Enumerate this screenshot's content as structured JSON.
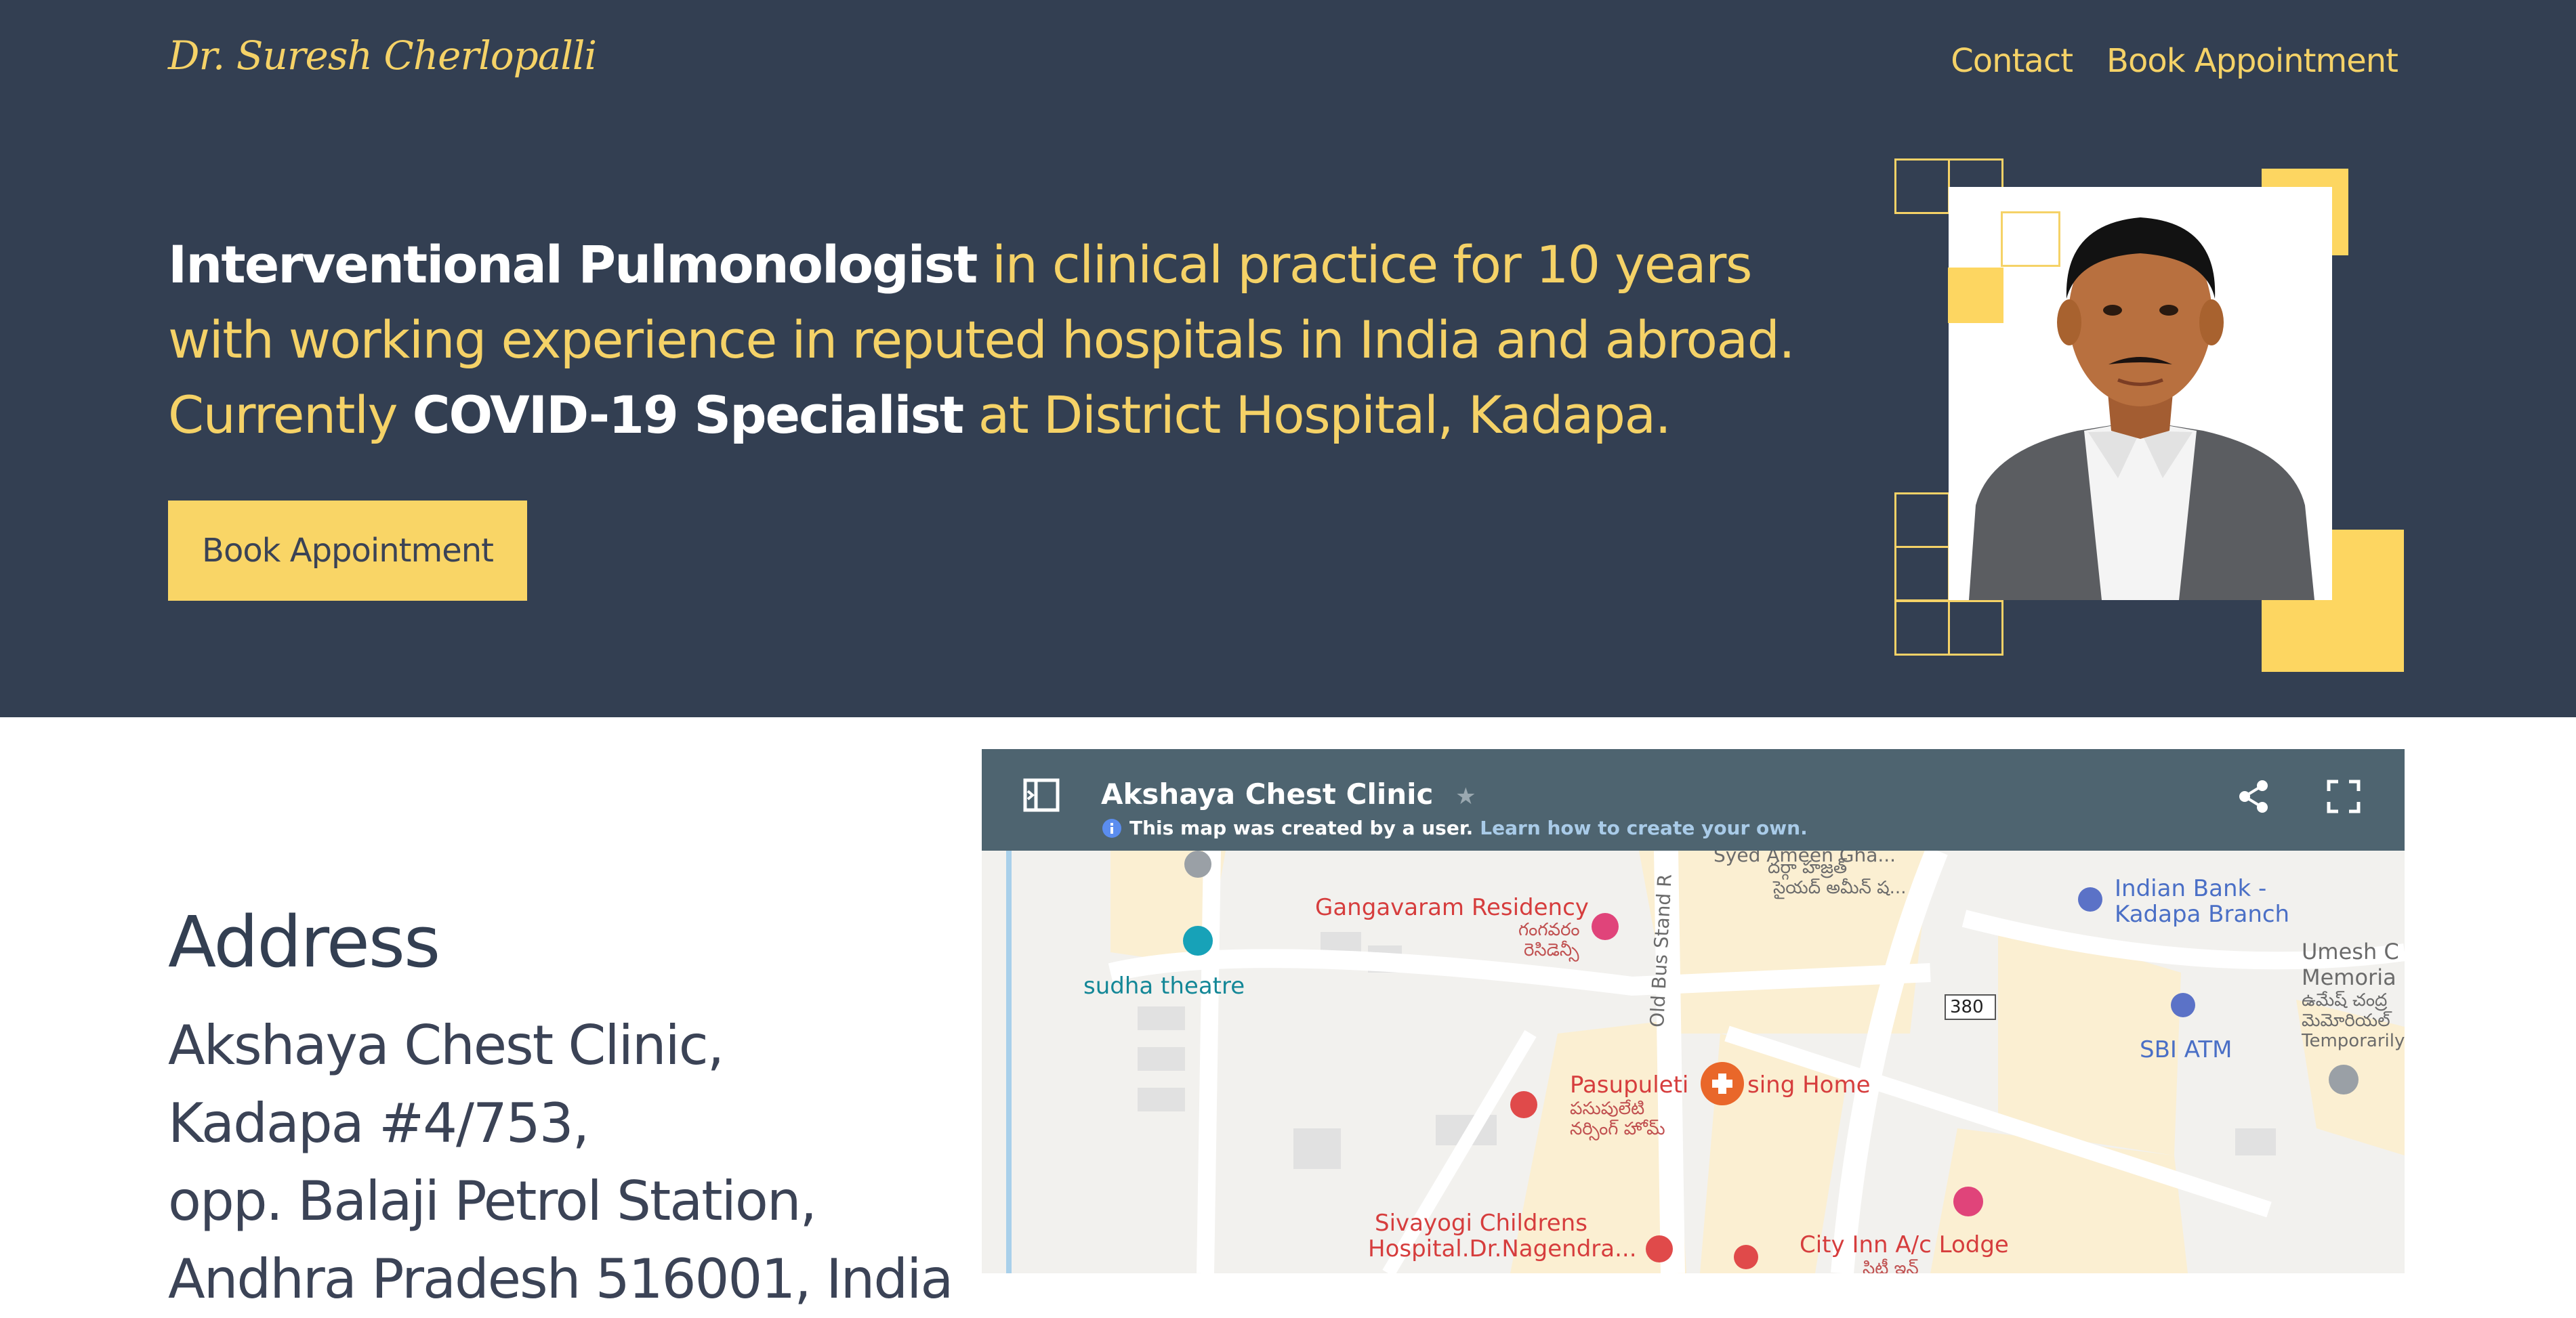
{
  "header": {
    "brand": "Dr. Suresh Cherlopalli",
    "nav": {
      "contact": "Contact",
      "book": "Book Appointment"
    }
  },
  "hero": {
    "part1_bold": "Interventional Pulmonologist",
    "part2": " in clinical practice for 10 years with working experience in reputed hospitals in India and abroad. Currently ",
    "part3_bold": "COVID-19 Specialist",
    "part4": " at District Hospital, Kadapa.",
    "cta": "Book Appointment"
  },
  "address": {
    "title": "Address",
    "lines": [
      "Akshaya Chest Clinic,",
      "Kadapa #4/753,",
      "opp. Balaji Petrol Station,",
      "Andhra Pradesh 516001, India"
    ]
  },
  "map": {
    "title": "Akshaya Chest Clinic",
    "notice": "This map was created by a user.",
    "learn_link": "Learn how to create your own.",
    "places": {
      "gangavaram": "Gangavaram Residency",
      "gangavaram_te": "గంగవరం",
      "gangavaram_te2": "రెసిడెన్సీ",
      "sudha": "sudha theatre",
      "road": "Old Bus Stand R",
      "syed": "Syed Ameen Gha...",
      "syed_te": "దర్గా హజ్రత్",
      "syed_te2": "సైయద్ అమీన్ ష...",
      "indian_bank": "Indian Bank -",
      "indian_bank2": "Kadapa Branch",
      "umesh": "Umesh C",
      "memorial": "Memoria",
      "umesh_te": "ఉమేష్ చంద్ర",
      "umesh_te2": "మెమోరియల్",
      "temporarily": "Temporarily",
      "sbi": "SBI ATM",
      "route": "380",
      "pasupuleti": "Pasupuleti",
      "nursing": "sing Home",
      "pasupuleti_te": "పసుపులేటి",
      "pasupuleti_te2": "నర్సింగ్ హోమ్",
      "sivayogi": "Sivayogi Childrens",
      "sivayogi2": "Hospital.Dr.Nagendra...",
      "cityinn": "City Inn A/c Lodge",
      "cityinn_te": "సిటీ ఇన్"
    }
  },
  "colors": {
    "navy": "#333f52",
    "yellow": "#f9d566"
  }
}
